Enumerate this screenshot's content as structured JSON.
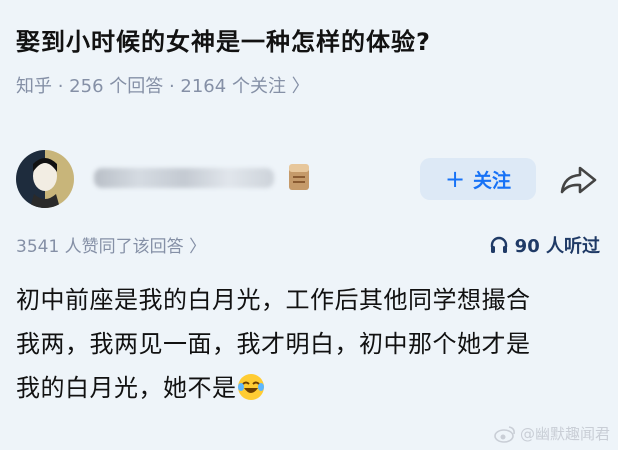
{
  "question": {
    "title": "娶到小时候的女神是一种怎样的体验?",
    "meta": "知乎 · 256 个回答 · 2164 个关注 〉"
  },
  "author": {
    "follow_label": "关注",
    "follow_plus": "+"
  },
  "stats": {
    "upvotes": "3541 人赞同了该回答 〉",
    "listeners": "90 人听过"
  },
  "answer": {
    "lines": [
      "初中前座是我的白月光，工作后其他同学想撮合",
      "我两，我两见一面，我才明白，初中那个她才是",
      "我的白月光，她不是"
    ]
  },
  "watermark": {
    "text": "@幽默趣闻君"
  },
  "colors": {
    "accent": "#1772f6",
    "muted": "#8590a6",
    "background": "#eef4f9"
  }
}
